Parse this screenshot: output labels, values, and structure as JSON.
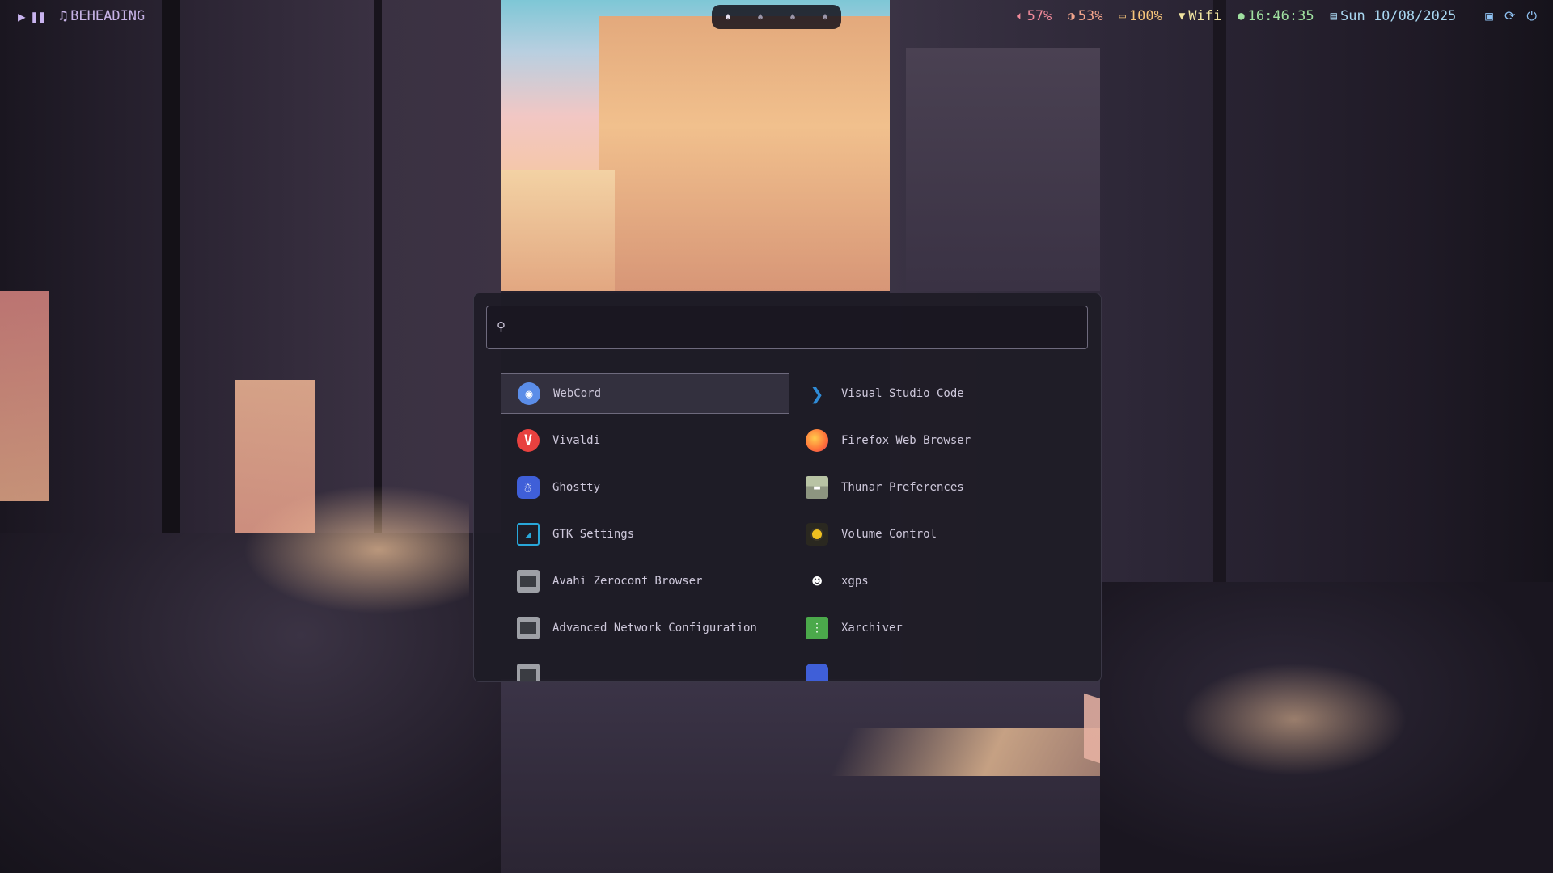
{
  "topbar": {
    "media": {
      "play_icon": "play-icon",
      "pause_icon": "pause-icon",
      "track_icon": "music-note-icon",
      "track": "BEHEADING"
    },
    "workspaces": [
      {
        "icon": "spade-icon",
        "active": true
      },
      {
        "icon": "spade-icon",
        "active": false
      },
      {
        "icon": "spade-icon",
        "active": false
      },
      {
        "icon": "spade-icon",
        "active": false
      }
    ],
    "volume": "57%",
    "brightness": "53%",
    "battery": "100%",
    "network": "Wifi",
    "time": "16:46:35",
    "date": "Sun 10/08/2025",
    "actions": [
      "lock-icon",
      "refresh-icon",
      "power-icon"
    ],
    "colors": {
      "volume": "#f28b9b",
      "brightness": "#f2a48b",
      "battery": "#f6c47a",
      "wifi": "#f0e3a0",
      "clock": "#9fe0a0",
      "date": "#a8d6f0",
      "actions": "#8fc2f2",
      "media": "#c7b3e6"
    }
  },
  "launcher": {
    "search": {
      "icon": "search-icon",
      "value": "",
      "placeholder": ""
    },
    "entries": [
      {
        "label": "WebCord",
        "icon": "webcord-icon",
        "selected": true
      },
      {
        "label": "Visual Studio Code",
        "icon": "vscode-icon"
      },
      {
        "label": "Vivaldi",
        "icon": "vivaldi-icon"
      },
      {
        "label": "Firefox Web Browser",
        "icon": "firefox-icon"
      },
      {
        "label": "Ghostty",
        "icon": "ghostty-icon"
      },
      {
        "label": "Thunar Preferences",
        "icon": "thunar-icon"
      },
      {
        "label": "GTK Settings",
        "icon": "gtk-settings-icon"
      },
      {
        "label": "Volume Control",
        "icon": "volume-control-icon"
      },
      {
        "label": "Avahi Zeroconf Browser",
        "icon": "avahi-icon"
      },
      {
        "label": "xgps",
        "icon": "xgps-icon"
      },
      {
        "label": "Advanced Network Configuration",
        "icon": "network-config-icon"
      },
      {
        "label": "Xarchiver",
        "icon": "xarchiver-icon"
      }
    ],
    "colors": {
      "background": "#1e1c26",
      "border": "#3a3746",
      "selected_bg": "#464252",
      "text": "#cfc9dc"
    }
  }
}
